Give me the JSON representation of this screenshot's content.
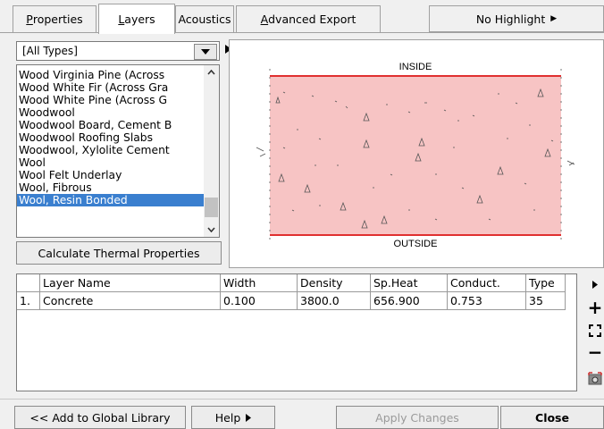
{
  "tabs": [
    {
      "label": "Properties",
      "mnemonic": "P",
      "rest": "roperties"
    },
    {
      "label": "Layers",
      "mnemonic": "L",
      "rest": "ayers"
    },
    {
      "label": "Acoustics"
    },
    {
      "label": "Advanced Export",
      "mnemonic": "A",
      "rest": "dvanced Export"
    }
  ],
  "highlight_menu": {
    "label": "No Highlight",
    "arrow": "▶"
  },
  "type_filter": {
    "value": "[All Types]"
  },
  "materials": [
    "Wood Virginia Pine (Across",
    "Wood White Fir (Across Gra",
    "Wood White Pine (Across G",
    "Woodwool",
    "Woodwool Board, Cement B",
    "Woodwool Roofing Slabs",
    "Woodwool, Xylolite Cement",
    "Wool",
    "Wool Felt Underlay",
    "Wool, Fibrous",
    "Wool, Resin Bonded"
  ],
  "selected_material": "Wool, Resin Bonded",
  "calc_button": "Calculate Thermal Properties",
  "preview": {
    "inside_label": "INSIDE",
    "outside_label": "OUTSIDE",
    "fill_color": "#f7c4c4",
    "line_color": "#e03030"
  },
  "table": {
    "headers": [
      "Layer Name",
      "Width",
      "Density",
      "Sp.Heat",
      "Conduct.",
      "Type"
    ],
    "rows": [
      {
        "index": "1.",
        "cells": [
          "Concrete",
          "0.100",
          "3800.0",
          "656.900",
          "0.753",
          "35"
        ]
      }
    ]
  },
  "tools": {
    "add": "+",
    "remove": "−"
  },
  "buttons": {
    "add_global": "<< Add to Global Library",
    "help": "Help",
    "apply": "Apply Changes",
    "close": "Close"
  }
}
